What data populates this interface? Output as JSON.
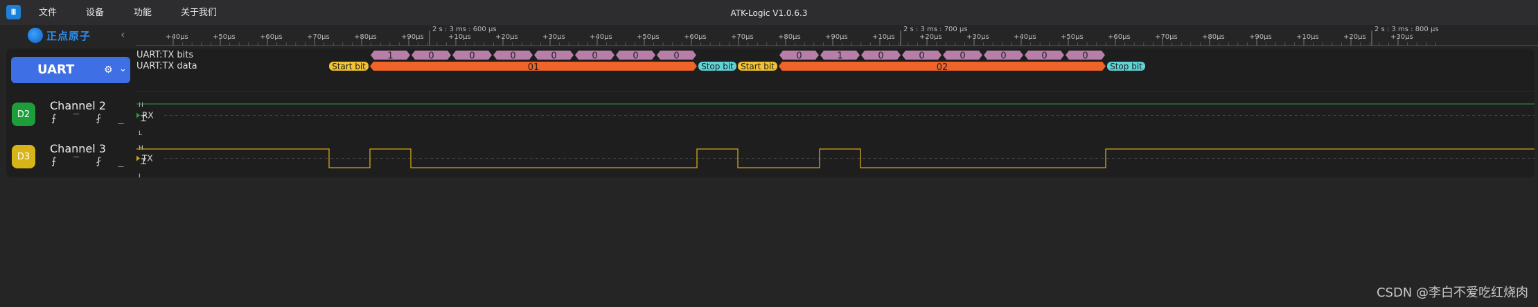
{
  "app": {
    "icon_glyph": "Ⅲ",
    "menu": [
      "文件",
      "设备",
      "功能",
      "关于我们"
    ],
    "title": "ATK-Logic  V1.0.6.3",
    "logo_text": "正点原子",
    "collapse_glyph": "‹"
  },
  "timeline": {
    "ticks": [
      "+40µs",
      "+50µs",
      "+60µs",
      "+70µs",
      "+80µs",
      "+90µs",
      "+10µs",
      "+20µs",
      "+30µs",
      "+40µs",
      "+50µs",
      "+60µs",
      "+70µs",
      "+80µs",
      "+90µs",
      "+10µs",
      "+20µs",
      "+30µs",
      "+40µs",
      "+50µs",
      "+60µs",
      "+70µs",
      "+80µs",
      "+90µs",
      "+10µs",
      "+20µs",
      "+30µs"
    ],
    "majors": [
      {
        "label": "2 s : 3 ms : 600 µs",
        "after_tick": 6
      },
      {
        "label": "2 s : 3 ms : 700 µs",
        "after_tick": 16
      },
      {
        "label": "2 s : 3 ms : 800 µs",
        "after_tick": 26
      }
    ]
  },
  "decoder": {
    "name": "UART",
    "rows": [
      "UART:TX bits",
      "UART:TX data"
    ],
    "frames": [
      {
        "start": "Start bit",
        "bits": [
          "1",
          "0",
          "0",
          "0",
          "0",
          "0",
          "0",
          "0"
        ],
        "data": "01",
        "stop": "Stop bit"
      },
      {
        "start": "Start bit",
        "bits": [
          "0",
          "1",
          "0",
          "0",
          "0",
          "0",
          "0",
          "0"
        ],
        "data": "02",
        "stop": "Stop bit"
      }
    ]
  },
  "channels": [
    {
      "badge": "D2",
      "name": "Channel 2",
      "signal": "RX",
      "color": "#1e9e3a",
      "trace": "#2e9b3e"
    },
    {
      "badge": "D3",
      "name": "Channel 3",
      "signal": "TX",
      "color": "#d8b418",
      "trace": "#d3a51a"
    }
  ],
  "levels": {
    "high": "H",
    "low": "L"
  },
  "trigger_glyphs": "⨍ ‾ ⨏ _ ⌶",
  "tx_levels": [
    1,
    0,
    1,
    0,
    0,
    0,
    0,
    0,
    0,
    0,
    0,
    1,
    0,
    0,
    1,
    0,
    0,
    0,
    0,
    0,
    0,
    1
  ],
  "colors": {
    "start_bit": "#f1c232",
    "stop_bit": "#5fd4d8",
    "bit": "#b77ea8",
    "data": "#f0642a",
    "accent": "#3f6fe5"
  },
  "watermark": "CSDN @李白不爱吃红烧肉"
}
